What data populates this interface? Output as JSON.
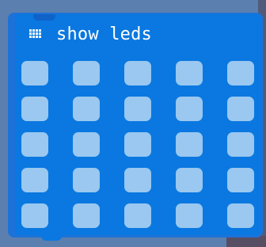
{
  "block": {
    "label": "show leds",
    "icon": "led-grid-icon"
  },
  "colors": {
    "workspace": "#5b7fae",
    "block_face": "#0a78e0",
    "block_edge": "#1c72d8",
    "led_off": "#9ac8f0",
    "led_on": "#ffffff",
    "text": "#ffffff"
  },
  "leds": [
    [
      false,
      false,
      false,
      false,
      false
    ],
    [
      false,
      false,
      false,
      false,
      false
    ],
    [
      false,
      false,
      false,
      false,
      false
    ],
    [
      false,
      false,
      false,
      false,
      false
    ],
    [
      false,
      false,
      false,
      false,
      false
    ]
  ]
}
